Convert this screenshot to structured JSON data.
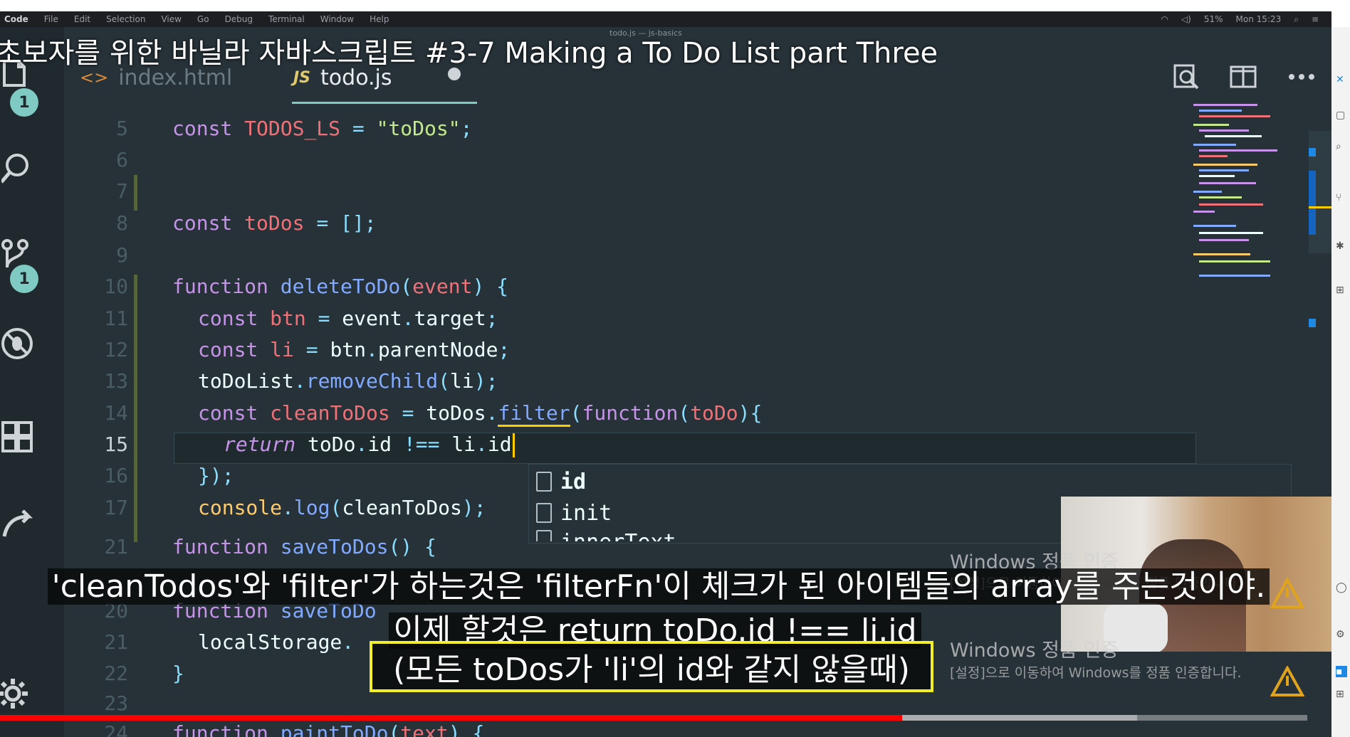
{
  "video": {
    "overlay_title": "초보자를 위한 바닐라 자바스크립트 #3-7 Making a To Do List part Three",
    "progress_percent": 69,
    "buffered_percent": 87
  },
  "menubar": {
    "app": "Code",
    "items": [
      "File",
      "Edit",
      "Selection",
      "View",
      "Go",
      "Debug",
      "Terminal",
      "Window",
      "Help"
    ],
    "battery": "51%",
    "clock": "Mon 15:23"
  },
  "window_title": "todo.js — js-basics",
  "tabs": [
    {
      "label": "index.html",
      "active": false
    },
    {
      "label": "todo.js",
      "active": true,
      "dirty": true
    }
  ],
  "activity_bar": {
    "explorer_badge": "1",
    "scm_badge": "1"
  },
  "code": {
    "lines": [
      {
        "n": "5",
        "text": "const TODOS_LS = \"toDos\";"
      },
      {
        "n": "6",
        "text": ""
      },
      {
        "n": "7",
        "text": ""
      },
      {
        "n": "8",
        "text": "const toDos = [];"
      },
      {
        "n": "9",
        "text": ""
      },
      {
        "n": "10",
        "text": "function deleteToDo(event) {"
      },
      {
        "n": "11",
        "text": "const btn = event.target;"
      },
      {
        "n": "12",
        "text": "const li = btn.parentNode;"
      },
      {
        "n": "13",
        "text": "toDoList.removeChild(li);"
      },
      {
        "n": "14",
        "text": "const cleanToDos = toDos.filter(function(toDo){"
      },
      {
        "n": "15",
        "text": "return toDo.id !== li.id"
      },
      {
        "n": "16",
        "text": "});"
      },
      {
        "n": "17",
        "text": "console.log(cleanToDos);"
      },
      {
        "n": "21",
        "text": "function saveToDos() {"
      },
      {
        "n": "20",
        "text": "function saveToDo"
      },
      {
        "n": "21",
        "text": "localStorage."
      },
      {
        "n": "22",
        "text": "}"
      },
      {
        "n": "23",
        "text": ""
      },
      {
        "n": "24",
        "text": "function paintToDo(text) {"
      }
    ]
  },
  "suggestions": [
    "id",
    "init",
    "innerText"
  ],
  "windows_activation": {
    "title": "Windows 정품 인증",
    "message": "[설정]으로 이동하여 Windows를 정품 인증합니다."
  },
  "subtitles": {
    "line1": "'cleanTodos'와 'filter'가 하는것은 'filterFn'이 체크가 된 아이템들의 array를 주는것이야.",
    "line2": "이제 할것은 return toDo.id !== li.id",
    "line3": "(모든 toDos가 'li'의 id와 같지 않을때)"
  },
  "colors": {
    "editor_bg": "#263238",
    "keyword": "#c792ea",
    "function": "#82aaff",
    "string": "#c3e88d",
    "variable": "#f07178",
    "progress": "#ff0000",
    "subtitle_highlight": "#f2ee2a"
  }
}
